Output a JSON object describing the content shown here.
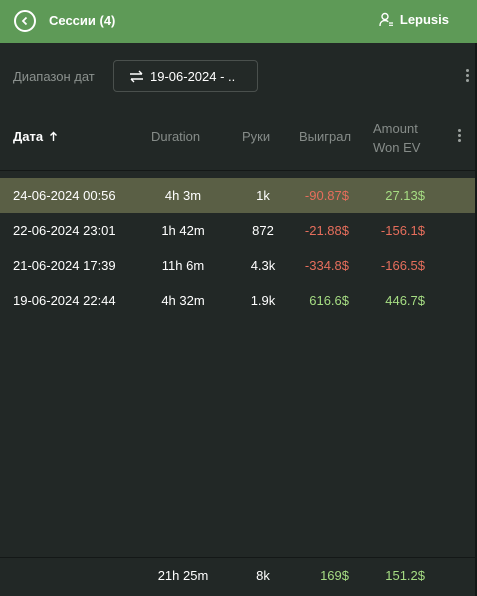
{
  "header": {
    "title": "Сессии (4)",
    "user": "Lepusis",
    "back_icon": "chevron-left-circle-icon",
    "user_icon": "user-icon",
    "color": "#5e9a57"
  },
  "filters": {
    "label": "Диапазон дат",
    "date_range": "19-06-2024 - ..",
    "swap_icon": "swap-arrows-icon"
  },
  "table": {
    "columns": {
      "date": "Дата",
      "duration": "Duration",
      "hands": "Руки",
      "won": "Выиграл",
      "ev_line1": "Amount",
      "ev_line2": "Won EV"
    },
    "sort_icon": "arrow-up-icon",
    "rows": [
      {
        "date": "24-06-2024 00:56",
        "duration": "4h 3m",
        "hands": "1k",
        "won": "-90.87$",
        "ev": "27.13$",
        "selected": true
      },
      {
        "date": "22-06-2024 23:01",
        "duration": "1h 42m",
        "hands": "872",
        "won": "-21.88$",
        "ev": "-156.1$",
        "selected": false
      },
      {
        "date": "21-06-2024 17:39",
        "duration": "11h 6m",
        "hands": "4.3k",
        "won": "-334.8$",
        "ev": "-166.5$",
        "selected": false
      },
      {
        "date": "19-06-2024 22:44",
        "duration": "4h 32m",
        "hands": "1.9k",
        "won": "616.6$",
        "ev": "446.7$",
        "selected": false
      }
    ],
    "totals": {
      "duration": "21h 25m",
      "hands": "8k",
      "won": "169$",
      "ev": "151.2$"
    }
  },
  "colors": {
    "positive": "#a6dd83",
    "negative": "#e66e5c",
    "selected_row": "#5a5f45"
  }
}
